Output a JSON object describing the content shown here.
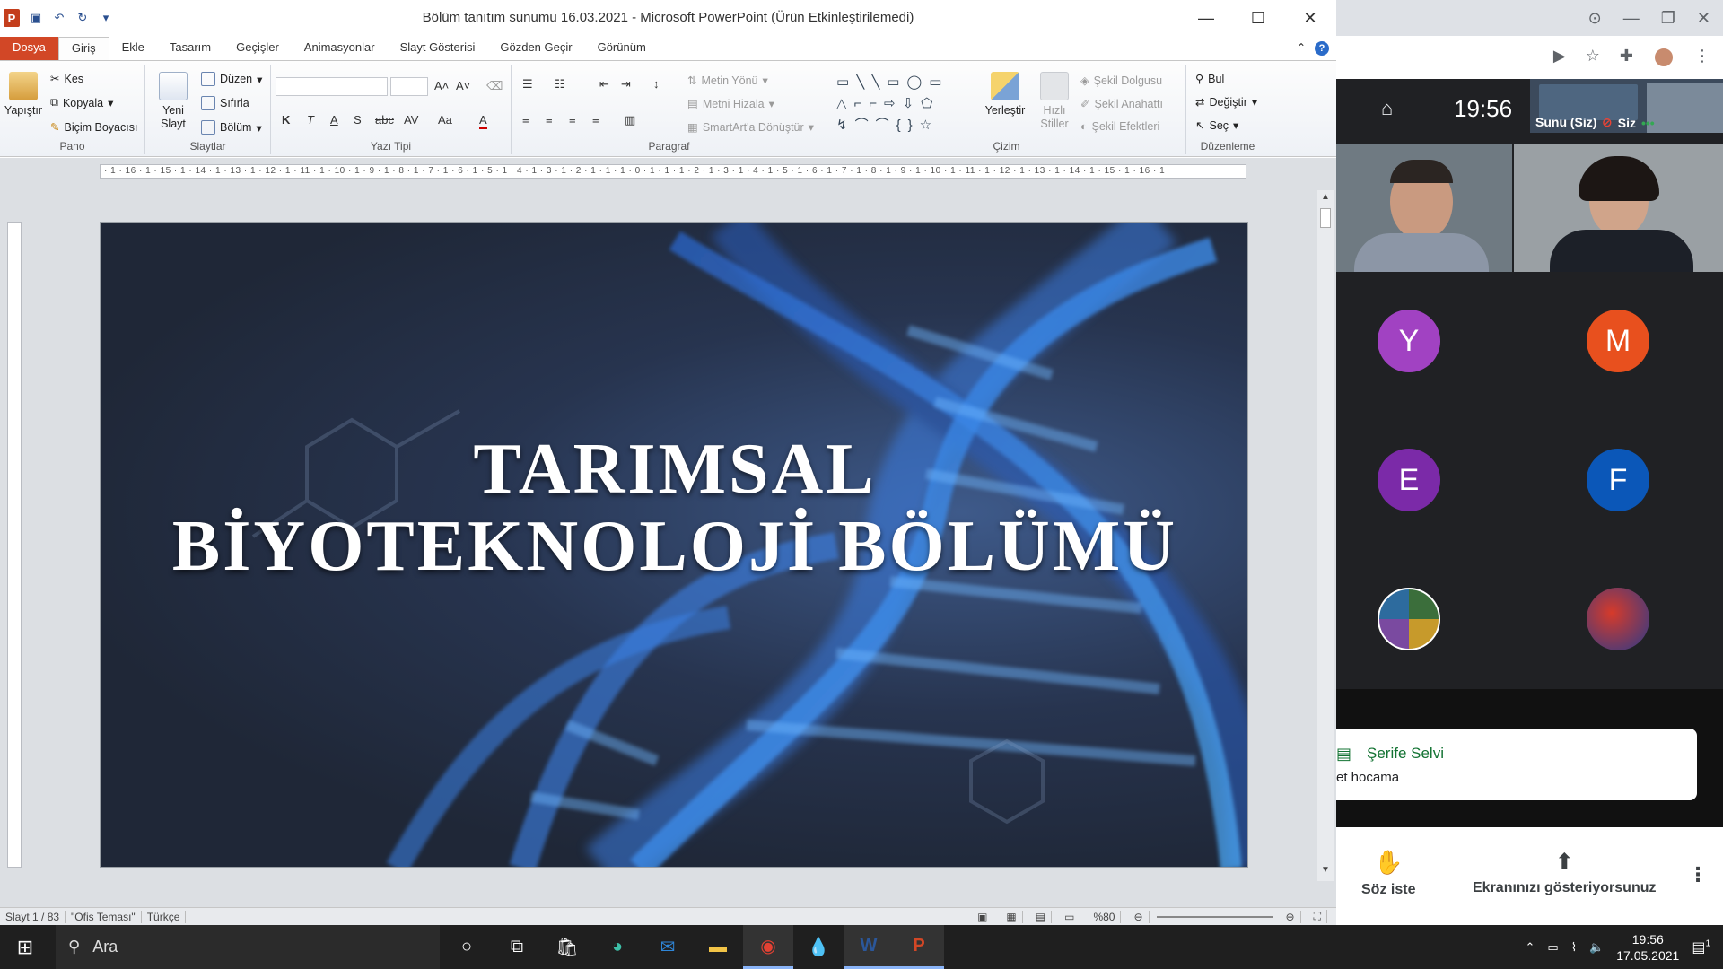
{
  "ppt": {
    "window_title": "Bölüm tanıtım sunumu 16.03.2021  -  Microsoft PowerPoint (Ürün Etkinleştirilemedi)",
    "tabs": [
      "Dosya",
      "Giriş",
      "Ekle",
      "Tasarım",
      "Geçişler",
      "Animasyonlar",
      "Slayt Gösterisi",
      "Gözden Geçir",
      "Görünüm"
    ],
    "groups": {
      "pano": {
        "label": "Pano",
        "paste": "Yapıştır",
        "cut": "Kes",
        "copy": "Kopyala",
        "format_painter": "Biçim Boyacısı"
      },
      "slaytlar": {
        "label": "Slaytlar",
        "new_slide": "Yeni Slayt",
        "layout": "Düzen",
        "reset": "Sıfırla",
        "section": "Bölüm"
      },
      "yazi_tipi": {
        "label": "Yazı Tipi"
      },
      "paragraf": {
        "label": "Paragraf",
        "text_direction": "Metin Yönü",
        "align_text": "Metni Hizala",
        "smartart": "SmartArt'a Dönüştür"
      },
      "cizim": {
        "label": "Çizim",
        "arrange": "Yerleştir",
        "quick_styles": "Hızlı Stiller",
        "shape_fill": "Şekil Dolgusu",
        "shape_outline": "Şekil Anahattı",
        "shape_effects": "Şekil Efektleri"
      },
      "duzenleme": {
        "label": "Düzenleme",
        "find": "Bul",
        "replace": "Değiştir",
        "select": "Seç"
      }
    },
    "hruler": "· 1 · 16 · 1 · 15 · 1 · 14 · 1 · 13 · 1 · 12 · 1 · 11 · 1 · 10 · 1 · 9 · 1 · 8 · 1 · 7 · 1 · 6 · 1 · 5 · 1 · 4 · 1 · 3 · 1 · 2 · 1 · 1 · 1 · 0 · 1 · 1 · 1 · 2 · 1 · 3 · 1 · 4 · 1 · 5 · 1 · 6 · 1 · 7 · 1 · 8 · 1 · 9 · 1 · 10 · 1 · 11 · 1 · 12 · 1 · 13 · 1 · 14 · 1 · 15 · 1 · 16 · 1",
    "slide": {
      "title_line1": "TARIMSAL",
      "title_line2": "BİYOTEKNOLOJİ BÖLÜMÜ"
    },
    "status": {
      "slide_num": "Slayt 1 / 83",
      "theme": "\"Ofis Teması\"",
      "language": "Türkçe",
      "zoom": "%80"
    }
  },
  "meet": {
    "clock": "19:56",
    "presenting_label": "Sunu (Siz)",
    "self_label": "Siz",
    "participants": [
      {
        "initial": "Y",
        "color": "#a142c2"
      },
      {
        "initial": "M",
        "color": "#e8501e"
      },
      {
        "initial": "E",
        "color": "#7b2aa8"
      },
      {
        "initial": "F",
        "color": "#0b57b8"
      }
    ],
    "chat": {
      "name": "Şerife Selvi",
      "message": "et hocama"
    },
    "buttons": {
      "raise_hand": "Söz iste",
      "presenting": "Ekranınızı gösteriyorsunuz"
    }
  },
  "taskbar": {
    "search": "Ara",
    "time": "19:56",
    "date": "17.05.2021",
    "notif_count": "1"
  }
}
